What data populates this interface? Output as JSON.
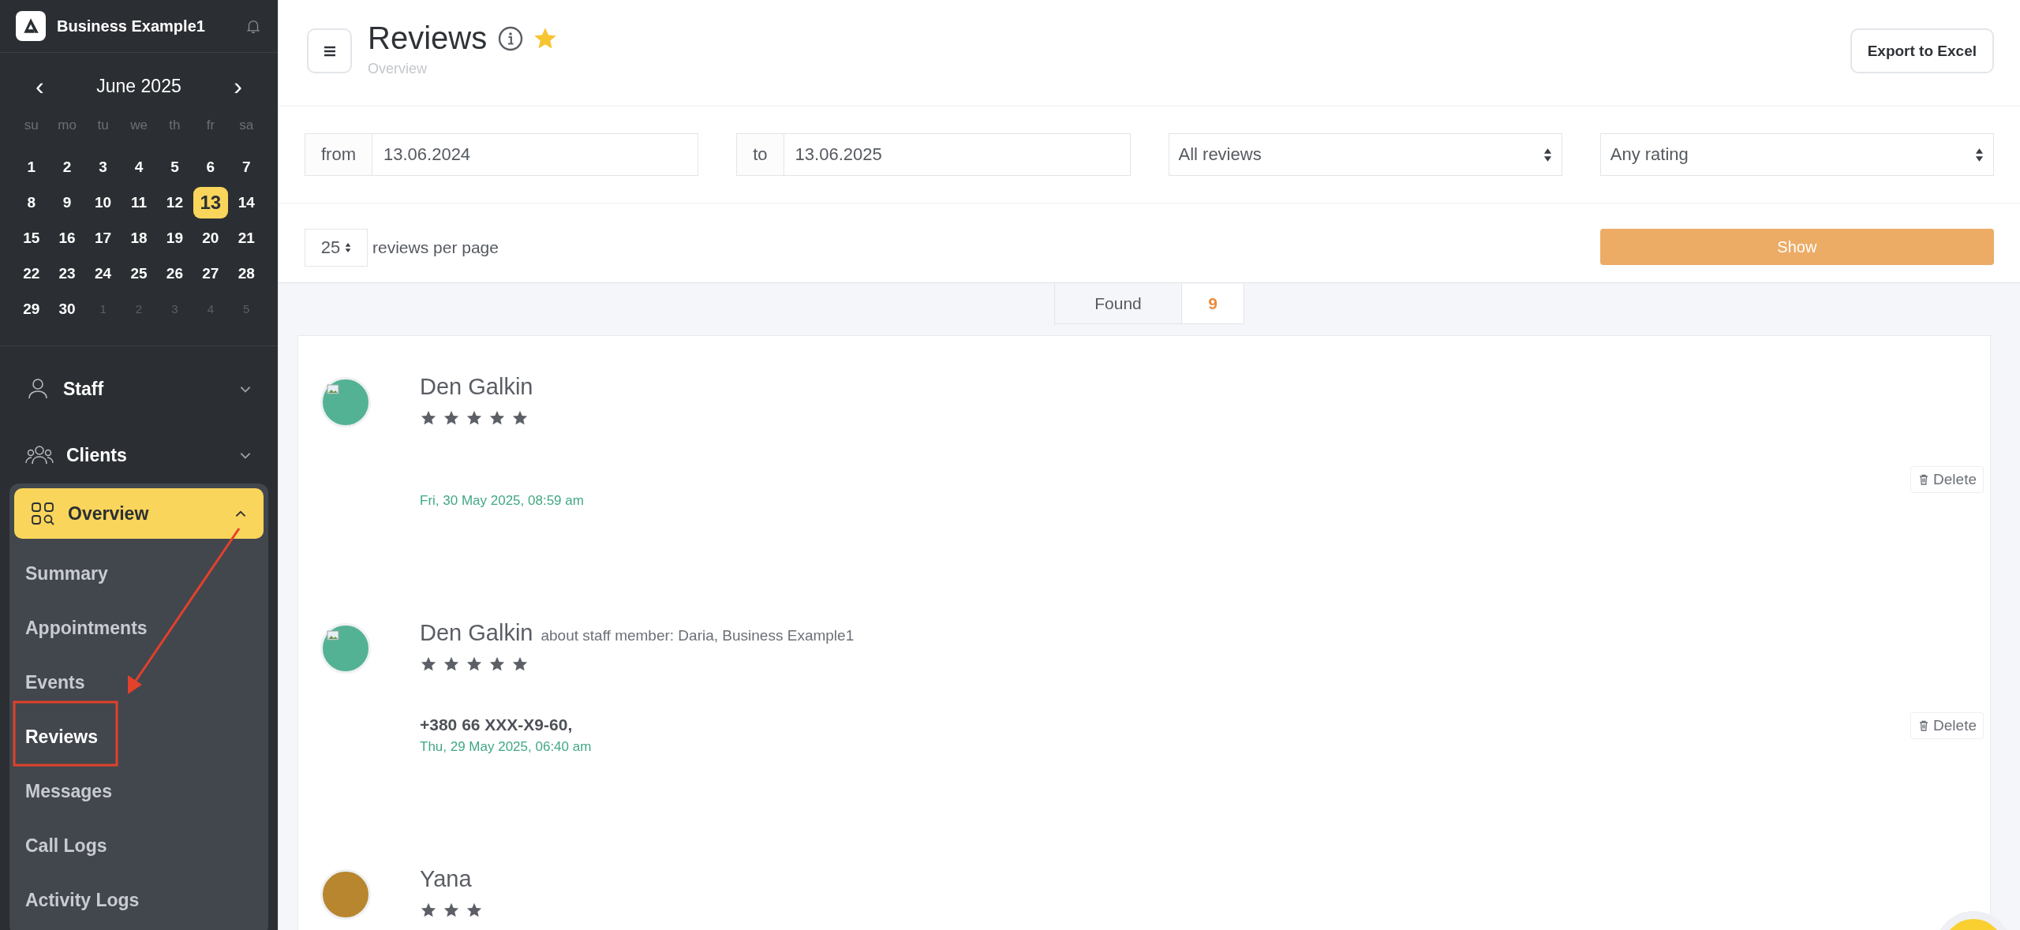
{
  "sidebar": {
    "business_name": "Business Example1",
    "calendar": {
      "month": "June 2025",
      "prev": "‹",
      "next": "›",
      "weekdays": [
        "su",
        "mo",
        "tu",
        "we",
        "th",
        "fr",
        "sa"
      ],
      "weeks": [
        [
          {
            "label": "1",
            "current_month": true,
            "selected": false
          },
          {
            "label": "2",
            "current_month": true,
            "selected": false
          },
          {
            "label": "3",
            "current_month": true,
            "selected": false
          },
          {
            "label": "4",
            "current_month": true,
            "selected": false
          },
          {
            "label": "5",
            "current_month": true,
            "selected": false
          },
          {
            "label": "6",
            "current_month": true,
            "selected": false
          },
          {
            "label": "7",
            "current_month": true,
            "selected": false
          }
        ],
        [
          {
            "label": "8",
            "current_month": true,
            "selected": false
          },
          {
            "label": "9",
            "current_month": true,
            "selected": false
          },
          {
            "label": "10",
            "current_month": true,
            "selected": false
          },
          {
            "label": "11",
            "current_month": true,
            "selected": false
          },
          {
            "label": "12",
            "current_month": true,
            "selected": false
          },
          {
            "label": "13",
            "current_month": true,
            "selected": true
          },
          {
            "label": "14",
            "current_month": true,
            "selected": false
          }
        ],
        [
          {
            "label": "15",
            "current_month": true,
            "selected": false
          },
          {
            "label": "16",
            "current_month": true,
            "selected": false
          },
          {
            "label": "17",
            "current_month": true,
            "selected": false
          },
          {
            "label": "18",
            "current_month": true,
            "selected": false
          },
          {
            "label": "19",
            "current_month": true,
            "selected": false
          },
          {
            "label": "20",
            "current_month": true,
            "selected": false
          },
          {
            "label": "21",
            "current_month": true,
            "selected": false
          }
        ],
        [
          {
            "label": "22",
            "current_month": true,
            "selected": false
          },
          {
            "label": "23",
            "current_month": true,
            "selected": false
          },
          {
            "label": "24",
            "current_month": true,
            "selected": false
          },
          {
            "label": "25",
            "current_month": true,
            "selected": false
          },
          {
            "label": "26",
            "current_month": true,
            "selected": false
          },
          {
            "label": "27",
            "current_month": true,
            "selected": false
          },
          {
            "label": "28",
            "current_month": true,
            "selected": false
          }
        ],
        [
          {
            "label": "29",
            "current_month": true,
            "selected": false
          },
          {
            "label": "30",
            "current_month": true,
            "selected": false
          },
          {
            "label": "1",
            "current_month": false,
            "selected": false
          },
          {
            "label": "2",
            "current_month": false,
            "selected": false
          },
          {
            "label": "3",
            "current_month": false,
            "selected": false
          },
          {
            "label": "4",
            "current_month": false,
            "selected": false
          },
          {
            "label": "5",
            "current_month": false,
            "selected": false
          }
        ]
      ]
    },
    "menu": [
      {
        "label": "Staff",
        "kind": "person",
        "expanded": false
      },
      {
        "label": "Clients",
        "kind": "people",
        "expanded": false
      },
      {
        "label": "Overview",
        "kind": "overview",
        "expanded": true,
        "children": [
          {
            "label": "Summary",
            "selected": false
          },
          {
            "label": "Appointments",
            "selected": false
          },
          {
            "label": "Events",
            "selected": false
          },
          {
            "label": "Reviews",
            "selected": true
          },
          {
            "label": "Messages",
            "selected": false
          },
          {
            "label": "Call Logs",
            "selected": false
          },
          {
            "label": "Activity Logs",
            "selected": false
          }
        ]
      }
    ]
  },
  "header": {
    "title": "Reviews",
    "favorite": true,
    "breadcrumb": "Overview",
    "export_button": "Export to Excel"
  },
  "filters": {
    "from_label": "from",
    "from_value": "13.06.2024",
    "to_label": "to",
    "to_value": "13.06.2025",
    "type_select": "All reviews",
    "rating_select": "Any rating",
    "per_page": "25",
    "per_page_label": "reviews per page",
    "show_button": "Show"
  },
  "found": {
    "label": "Found",
    "count": "9"
  },
  "reviews": [
    {
      "name": "Den Galkin",
      "kind": "broken_image",
      "stars": 5,
      "date": "Fri, 30 May 2025, 08:59 am",
      "delete": "Delete"
    },
    {
      "name": "Den Galkin",
      "about": "about staff member: Daria, Business Example1",
      "kind": "broken_image",
      "stars": 5,
      "phone": "+380 66 XXX-X9-60,",
      "date": "Thu, 29 May 2025, 06:40 am",
      "delete": "Delete"
    },
    {
      "name": "Yana",
      "kind": "photo",
      "stars": 3
    }
  ]
}
